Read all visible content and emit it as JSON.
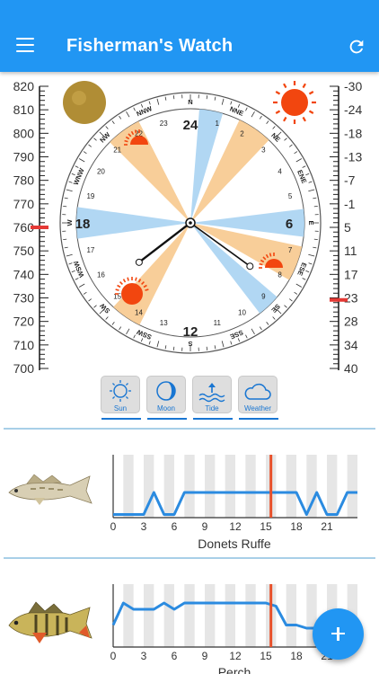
{
  "app": {
    "title": "Fisherman's Watch"
  },
  "icons": {
    "menu": "menu-icon",
    "refresh": "refresh-icon",
    "add": "plus-icon"
  },
  "colors": {
    "primary": "#2196f3",
    "marker": "#e53935",
    "sun_band": "#f7c98e",
    "moon_band": "#a9d3f2",
    "chart_line": "#2b8be0",
    "now_line": "#e8502a"
  },
  "pressure_scale": {
    "labels": [
      "820",
      "810",
      "800",
      "790",
      "780",
      "770",
      "760",
      "750",
      "740",
      "730",
      "720",
      "710",
      "700"
    ],
    "marker_value": 760
  },
  "temperature_scale": {
    "labels": [
      "-30",
      "-24",
      "-18",
      "-13",
      "-7",
      "-1",
      "5",
      "11",
      "17",
      "23",
      "28",
      "34",
      "40"
    ],
    "marker_value": 23
  },
  "dial": {
    "center_marker": "24",
    "hour_labels": {
      "top": "24",
      "right": "6",
      "bottom": "12",
      "left": "18"
    },
    "minor_hours": [
      "1",
      "2",
      "3",
      "4",
      "5",
      "7",
      "8",
      "9",
      "10",
      "11",
      "13",
      "14",
      "15",
      "16",
      "17",
      "19",
      "20",
      "21",
      "22",
      "23"
    ],
    "directions": [
      "N",
      "NNE",
      "NE",
      "ENE",
      "E",
      "ESE",
      "SE",
      "SSE",
      "S",
      "SSW",
      "SW",
      "WSW",
      "W",
      "WNW",
      "NW",
      "NNW"
    ],
    "sun_times": {
      "sunrise": 5.2,
      "sunset": 21.9
    },
    "current_time": {
      "hour": 15.5
    }
  },
  "modes": [
    {
      "label": "Sun",
      "icon": "sun-icon"
    },
    {
      "label": "Moon",
      "icon": "moon-icon"
    },
    {
      "label": "Tide",
      "icon": "tide-icon"
    },
    {
      "label": "Weather",
      "icon": "cloud-icon"
    }
  ],
  "fish": [
    {
      "name": "Donets Ruffe",
      "icon": "ruffe-fish-icon",
      "chart_data": {
        "type": "line",
        "x": [
          0,
          1,
          2,
          3,
          4,
          5,
          6,
          7,
          8,
          9,
          10,
          11,
          12,
          13,
          14,
          15,
          16,
          17,
          18,
          19,
          20,
          21,
          22,
          23,
          24
        ],
        "values": [
          0.05,
          0.05,
          0.05,
          0.05,
          0.4,
          0.05,
          0.05,
          0.4,
          0.4,
          0.4,
          0.4,
          0.4,
          0.4,
          0.4,
          0.4,
          0.4,
          0.4,
          0.4,
          0.4,
          0.05,
          0.4,
          0.05,
          0.05,
          0.4,
          0.4
        ],
        "x_ticks": [
          "0",
          "3",
          "6",
          "9",
          "12",
          "15",
          "18",
          "21"
        ],
        "now_x": 15.5
      }
    },
    {
      "name": "Perch",
      "icon": "perch-fish-icon",
      "chart_data": {
        "type": "line",
        "x": [
          0,
          1,
          2,
          3,
          4,
          5,
          6,
          7,
          8,
          9,
          10,
          11,
          12,
          13,
          14,
          15,
          16,
          17,
          18,
          19,
          20,
          21,
          22,
          23,
          24
        ],
        "values": [
          0.35,
          0.7,
          0.6,
          0.6,
          0.6,
          0.7,
          0.6,
          0.7,
          0.7,
          0.7,
          0.7,
          0.7,
          0.7,
          0.7,
          0.7,
          0.7,
          0.65,
          0.35,
          0.35,
          0.3,
          0.3,
          0.25,
          0.2,
          0.35,
          0.35
        ],
        "x_ticks": [
          "0",
          "3",
          "6",
          "9",
          "12",
          "15",
          "18",
          "21"
        ],
        "now_x": 15.5
      }
    }
  ]
}
